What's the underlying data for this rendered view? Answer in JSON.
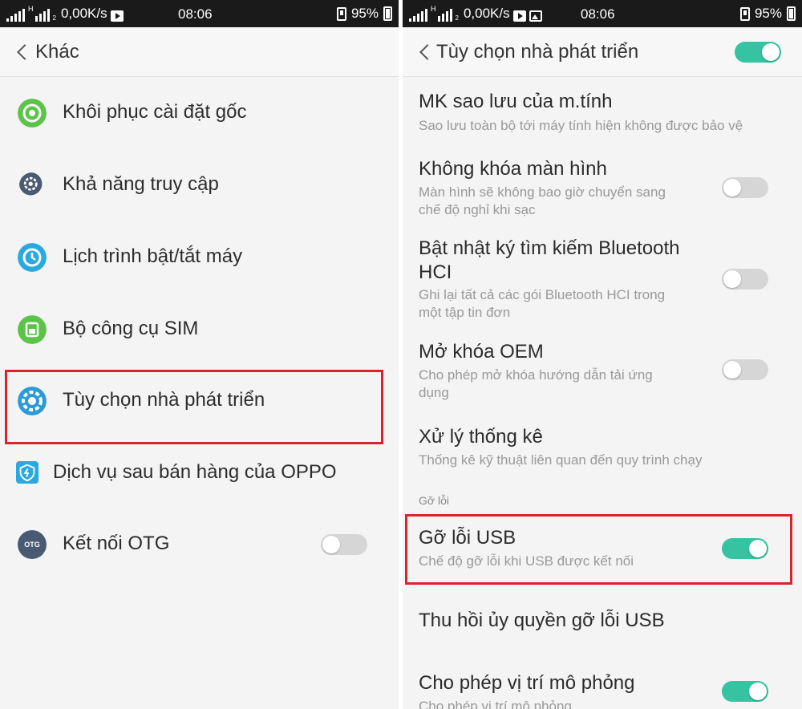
{
  "colors": {
    "accent": "#35c3a2",
    "highlight": "#d9242b",
    "statusbar": "#1a1a1a"
  },
  "left": {
    "status": {
      "net_letter": "H",
      "sim_num": "2",
      "speed": "0,00K/s",
      "time": "08:06",
      "battery": "95%"
    },
    "title": "Khác",
    "items": [
      {
        "label": "Khôi phục cài đặt gốc",
        "icon": "factory-reset-icon"
      },
      {
        "label": "Khả năng truy cập",
        "icon": "accessibility-icon"
      },
      {
        "label": "Lịch trình bật/tắt máy",
        "icon": "schedule-power-icon"
      },
      {
        "label": "Bộ công cụ SIM",
        "icon": "sim-toolkit-icon"
      },
      {
        "label": "Tùy chọn nhà phát triển",
        "icon": "developer-options-icon"
      },
      {
        "label": "Dịch vụ sau bán hàng của OPPO",
        "icon": "oppo-service-icon"
      },
      {
        "label": "Kết nối OTG",
        "icon": "otg-icon",
        "icon_text": "OTG",
        "toggle": false
      }
    ]
  },
  "right": {
    "status": {
      "net_letter": "H",
      "sim_num": "2",
      "speed": "0,00K/s",
      "time": "08:06",
      "battery": "95%"
    },
    "title": "Tùy chọn nhà phát triển",
    "master_toggle": true,
    "settings": [
      {
        "title": "MK sao lưu của m.tính",
        "desc": "Sao lưu toàn bộ tới máy tính hiện không được bảo vệ"
      },
      {
        "title": "Không khóa màn hình",
        "desc_1": "Màn hình sẽ không bao giờ chuyển sang",
        "desc_2": "chế độ nghỉ khi sạc",
        "toggle": false
      },
      {
        "title_1": "Bật nhật ký tìm kiếm Bluetooth",
        "title_2": "HCI",
        "desc_1": "Ghi lại tất cả các gói Bluetooth HCI trong",
        "desc_2": "một tập tin đơn",
        "toggle": false
      },
      {
        "title": "Mở khóa OEM",
        "desc_1": "Cho phép mở khóa hướng dẫn tải ứng",
        "desc_2": "dụng",
        "toggle": false
      },
      {
        "title": "Xử lý thống kê",
        "desc": "Thống kê kỹ thuật liên quan đến quy trình chạy"
      },
      {
        "title": "Gỡ lỗi USB",
        "desc": "Chế độ gỡ lỗi khi USB được kết nối",
        "toggle": true
      },
      {
        "title": "Thu hồi ủy quyền gỡ lỗi USB"
      },
      {
        "title": "Cho phép vị trí mô phỏng",
        "desc": "Cho phép vị trí mô phỏng",
        "toggle": true
      }
    ],
    "section_debug": "Gỡ lỗi"
  }
}
